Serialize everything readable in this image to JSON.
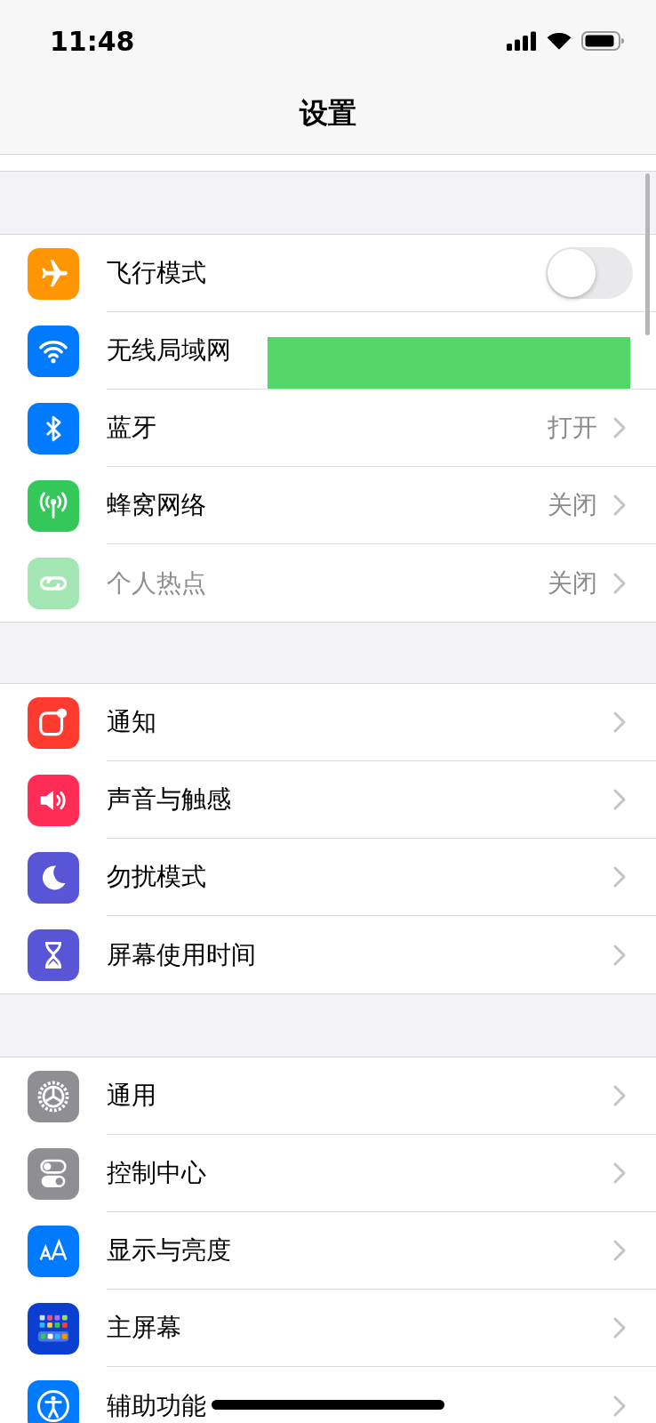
{
  "status_bar": {
    "time": "11:48"
  },
  "nav": {
    "title": "设置"
  },
  "groups": [
    {
      "rows": [
        {
          "kind": "toggle",
          "label": "飞行模式",
          "on": false,
          "disabled": false
        },
        {
          "kind": "link",
          "label": "无线局域网",
          "disabled": false,
          "redacted": true
        },
        {
          "kind": "link",
          "label": "蓝牙",
          "value": "打开",
          "disabled": false
        },
        {
          "kind": "link",
          "label": "蜂窝网络",
          "value": "关闭",
          "disabled": false
        },
        {
          "kind": "link",
          "label": "个人热点",
          "value": "关闭",
          "disabled": true
        }
      ]
    },
    {
      "rows": [
        {
          "kind": "link",
          "label": "通知",
          "disabled": false
        },
        {
          "kind": "link",
          "label": "声音与触感",
          "disabled": false
        },
        {
          "kind": "link",
          "label": "勿扰模式",
          "disabled": false
        },
        {
          "kind": "link",
          "label": "屏幕使用时间",
          "disabled": false
        }
      ]
    },
    {
      "rows": [
        {
          "kind": "link",
          "label": "通用",
          "disabled": false
        },
        {
          "kind": "link",
          "label": "控制中心",
          "disabled": false
        },
        {
          "kind": "link",
          "label": "显示与亮度",
          "disabled": false
        },
        {
          "kind": "link",
          "label": "主屏幕",
          "disabled": false
        },
        {
          "kind": "link",
          "label": "辅助功能",
          "disabled": false
        }
      ]
    }
  ]
}
